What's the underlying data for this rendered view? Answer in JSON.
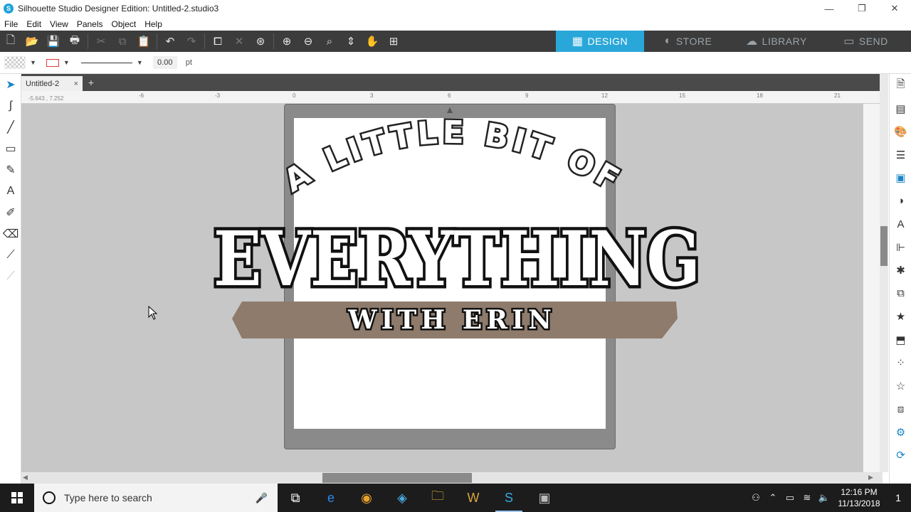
{
  "window": {
    "title": "Silhouette Studio Designer Edition: Untitled-2.studio3",
    "app_icon": "S",
    "minimize": "—",
    "maximize": "❐",
    "close": "✕"
  },
  "menu": [
    "File",
    "Edit",
    "View",
    "Panels",
    "Object",
    "Help"
  ],
  "nav_tabs": {
    "design": "DESIGN",
    "store": "STORE",
    "library": "LIBRARY",
    "send": "SEND"
  },
  "properties": {
    "line_weight": "0.00",
    "unit": "pt"
  },
  "document": {
    "tab_label": "Untitled-2",
    "tab_close": "×",
    "add_tab": "+",
    "cursor_coords": "-5.643 , 7.252"
  },
  "ruler": {
    "h_ticks": [
      "-6",
      "-3",
      "0",
      "3",
      "6",
      "9",
      "12",
      "15",
      "18",
      "21"
    ]
  },
  "design": {
    "arc_text": "A LITTLE BIT OF",
    "main_text": "EVERYTHING",
    "banner_text": "WITH ERIN",
    "banner_color": "#8e7b6c"
  },
  "taskbar": {
    "search_placeholder": "Type here to search",
    "time": "12:16 PM",
    "date": "11/13/2018",
    "notifications": "1"
  },
  "colors": {
    "accent": "#2aa7d9",
    "toolbar": "#3c3c3c",
    "canvas": "#c7c7c7"
  }
}
